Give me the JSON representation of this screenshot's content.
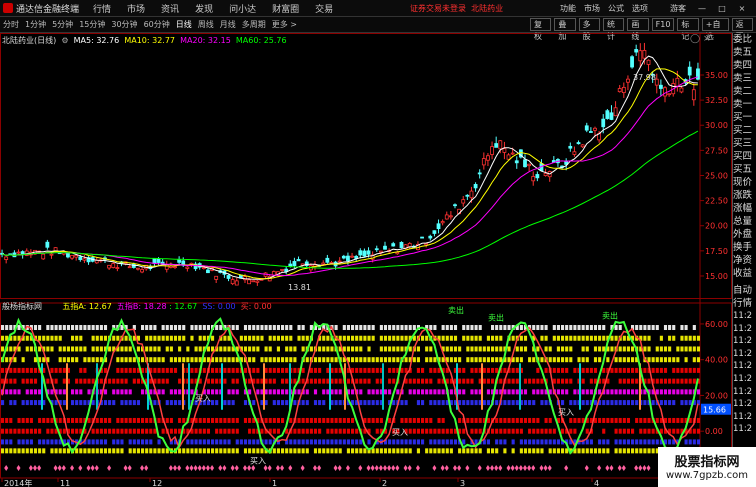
{
  "topbar": {
    "app_title": "通达信金融终端",
    "menu": [
      "行情",
      "市场",
      "资讯",
      "发现",
      "问小达",
      "财富圈",
      "交易"
    ],
    "notice_login": "证券交易未登录",
    "notice_stock": "北陆药业",
    "right_items": [
      "功能",
      "市场",
      "公式",
      "选项"
    ],
    "guest": "游客",
    "win_buttons": [
      "—",
      "□",
      "×"
    ]
  },
  "periodbar": {
    "periods": [
      "分时",
      "1分钟",
      "5分钟",
      "15分钟",
      "30分钟",
      "60分钟",
      "日线",
      "周线",
      "月线",
      "多周期",
      "更多 >"
    ],
    "active": "日线",
    "tools": [
      "复权",
      "叠加",
      "多股",
      "统计",
      "画线",
      "F10",
      "标记",
      "+自选",
      "返回"
    ]
  },
  "main_legend": {
    "name": "北陆药业(日线)",
    "items": [
      {
        "label": "MA5: 32.76",
        "color": "#ffffff"
      },
      {
        "label": "MA10: 32.77",
        "color": "#ffff00"
      },
      {
        "label": "MA20: 32.15",
        "color": "#ff00ff"
      },
      {
        "label": "MA60: 25.76",
        "color": "#00ff00"
      }
    ],
    "high_label": "37.98",
    "low_label": "13.81"
  },
  "price_axis": [
    "35.00",
    "32.50",
    "30.00",
    "27.50",
    "25.00",
    "22.50",
    "20.00",
    "17.50",
    "15.00"
  ],
  "indicator_legend": {
    "name": "般杨指标网",
    "items": [
      {
        "label": "五指A: 12.67",
        "color": "#ffff00"
      },
      {
        "label": "五指B: 18.28",
        "color": "#ff00ff"
      },
      {
        "label": ": 12.67",
        "color": "#00ff00"
      },
      {
        "label": "SS: 0.00",
        "color": "#0000ff"
      },
      {
        "label": "买: 0.00",
        "color": "#ff0000"
      }
    ],
    "buy_label": "买入",
    "sell_label": "卖出",
    "current_value": "15.66"
  },
  "indicator_axis": [
    "60.00",
    "40.00",
    "20.00",
    "0.00"
  ],
  "date_axis": [
    "2014年",
    "11",
    "12",
    "1",
    "2",
    "3",
    "4"
  ],
  "right_panel": {
    "quote_labels": [
      "委比",
      "卖五",
      "卖四",
      "卖三",
      "卖二",
      "卖一",
      "买一",
      "买二",
      "买三",
      "买四",
      "买五",
      "现价",
      "涨跌",
      "涨幅",
      "总量",
      "外盘",
      "换手",
      "净资",
      "收益"
    ],
    "detail_labels": [
      "自动",
      "行情"
    ],
    "times": [
      "11:2",
      "11:2",
      "11:2",
      "11:2",
      "11:2",
      "11:2",
      "11:2",
      "11:2",
      "11:2",
      "11:2"
    ]
  },
  "watermark": {
    "line1": "股票指标网",
    "line2": "www.7gpzb.com"
  },
  "colors": {
    "up": "#ff3232",
    "down": "#54ffff",
    "ma5": "#ffffff",
    "ma10": "#ffff00",
    "ma20": "#ff00ff",
    "ma60": "#00ff00"
  }
}
